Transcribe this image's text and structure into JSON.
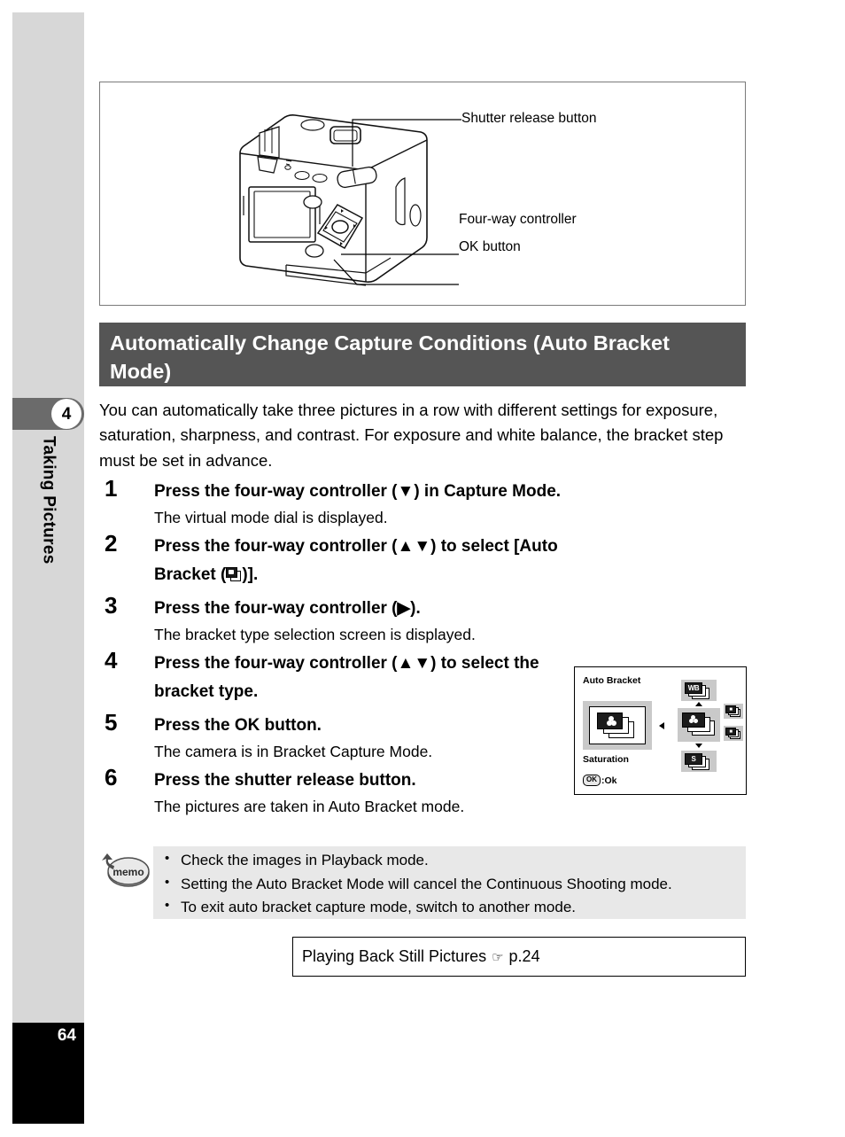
{
  "chapter": {
    "number": "4",
    "title": "Taking Pictures",
    "page_number": "64"
  },
  "figure": {
    "name": "camera-rear-view",
    "callouts": [
      {
        "id": "shutter-release",
        "label": "Shutter release button"
      },
      {
        "id": "four-way-controller",
        "label": "Four-way controller"
      },
      {
        "id": "ok-button",
        "label": "OK button"
      }
    ]
  },
  "section": {
    "heading": "Automatically Change Capture Conditions (Auto Bracket Mode)",
    "intro": "You can automatically take three pictures in a row with different settings for exposure, saturation, sharpness, and contrast. For exposure and white balance, the bracket step must be set in advance."
  },
  "steps": [
    {
      "number": "1",
      "title_before": "Press the four-way controller (▼) in Capture Mode.",
      "title_after": "",
      "icon": "",
      "desc": "The virtual mode dial is displayed."
    },
    {
      "number": "2",
      "title_before": "Press the four-way controller (▲▼) to select [Auto Bracket (",
      "title_after": ")].",
      "icon": "auto-bracket-icon",
      "desc": ""
    },
    {
      "number": "3",
      "title_before": "Press the four-way controller (▶).",
      "title_after": "",
      "icon": "",
      "desc": "The bracket type selection screen is displayed."
    },
    {
      "number": "4",
      "title_before": "Press the four-way controller (▲▼) to select the bracket type.",
      "title_after": "",
      "icon": "",
      "desc": ""
    },
    {
      "number": "5",
      "title_before": "Press the OK button.",
      "title_after": "",
      "icon": "",
      "desc": "The camera is in Bracket Capture Mode."
    },
    {
      "number": "6",
      "title_before": "Press the shutter release button.",
      "title_after": "",
      "icon": "",
      "desc": "The pictures are taken in Auto Bracket mode."
    }
  ],
  "lcd_screen": {
    "title": "Auto Bracket",
    "selected_label": "Saturation",
    "ok_key": "OK",
    "ok_action": ":Ok",
    "options": [
      {
        "id": "white-balance-bracket",
        "glyph": "WB",
        "position": "up"
      },
      {
        "id": "saturation-bracket",
        "glyph": "dots",
        "position": "center"
      },
      {
        "id": "sharpness-bracket",
        "glyph": "S",
        "position": "down"
      },
      {
        "id": "exposure-bracket",
        "glyph": "exp",
        "position": "right-upper"
      },
      {
        "id": "contrast-bracket",
        "glyph": "con",
        "position": "right-lower"
      }
    ]
  },
  "memo": {
    "badge_label": "memo",
    "items": [
      "Check the images in Playback mode.",
      "Setting the Auto Bracket Mode will cancel the Continuous Shooting mode.",
      "To exit auto bracket capture mode, switch to another mode."
    ]
  },
  "cross_reference": {
    "text": "Playing Back Still Pictures",
    "pointer": "☞",
    "page": "p.24"
  },
  "colors": {
    "rail_gray": "#d7d7d7",
    "tab_gray": "#6b6b6b",
    "heading_band": "#555555",
    "memo_gray": "#e8e8e8",
    "lcd_cell_gray": "#c9c9c9",
    "footer_black": "#000000"
  }
}
